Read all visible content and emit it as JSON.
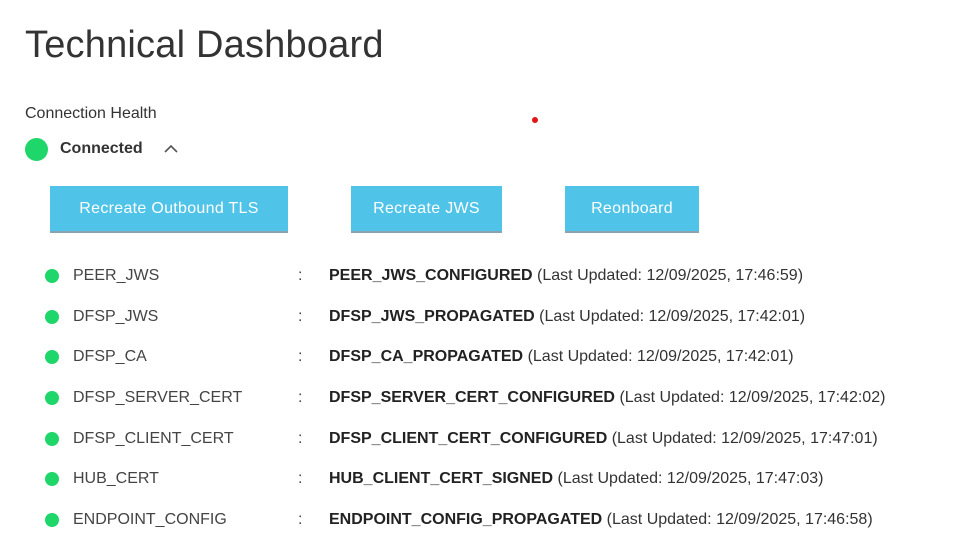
{
  "page": {
    "title": "Technical Dashboard"
  },
  "connection": {
    "label": "Connection Health",
    "status": "Connected",
    "status_color": "#1fd66a",
    "toggle_icon": "chevron-up-icon"
  },
  "actions": {
    "recreate_tls": "Recreate Outbound TLS",
    "recreate_jws": "Recreate JWS",
    "reonboard": "Reonboard",
    "button_color": "#4fc3e8"
  },
  "separator": ":",
  "rows": [
    {
      "name": "PEER_JWS",
      "state": "PEER_JWS_CONFIGURED",
      "updated": "(Last Updated: 12/09/2025, 17:46:59)"
    },
    {
      "name": "DFSP_JWS",
      "state": "DFSP_JWS_PROPAGATED",
      "updated": "(Last Updated: 12/09/2025, 17:42:01)"
    },
    {
      "name": "DFSP_CA",
      "state": "DFSP_CA_PROPAGATED",
      "updated": "(Last Updated: 12/09/2025, 17:42:01)"
    },
    {
      "name": "DFSP_SERVER_CERT",
      "state": "DFSP_SERVER_CERT_CONFIGURED",
      "updated": "(Last Updated: 12/09/2025, 17:42:02)"
    },
    {
      "name": "DFSP_CLIENT_CERT",
      "state": "DFSP_CLIENT_CERT_CONFIGURED",
      "updated": "(Last Updated: 12/09/2025, 17:47:01)"
    },
    {
      "name": "HUB_CERT",
      "state": "HUB_CLIENT_CERT_SIGNED",
      "updated": "(Last Updated: 12/09/2025, 17:47:03)"
    },
    {
      "name": "ENDPOINT_CONFIG",
      "state": "ENDPOINT_CONFIG_PROPAGATED",
      "updated": "(Last Updated: 12/09/2025, 17:46:58)"
    }
  ]
}
